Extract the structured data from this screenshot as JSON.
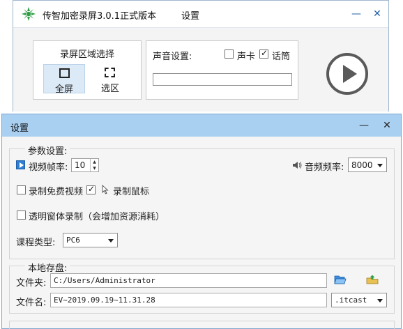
{
  "recorder": {
    "title": "传智加密录屏3.0.1正式版本",
    "settings_link": "设置",
    "region": {
      "title": "录屏区域选择",
      "fullscreen_label": "全屏",
      "selection_label": "选区",
      "active": "fullscreen"
    },
    "sound": {
      "label": "声音设置:",
      "sound_card_label": "声卡",
      "sound_card_checked": false,
      "microphone_label": "话筒",
      "microphone_checked": true
    },
    "icons": [
      "app-logo-icon",
      "minimize-icon",
      "close-icon",
      "play-icon"
    ]
  },
  "settings": {
    "title": "设置",
    "params": {
      "legend": "参数设置:",
      "fps_label": "视频帧率:",
      "fps_value": "10",
      "audio_rate_label": "音频频率:",
      "audio_rate_value": "8000",
      "record_free_video_label": "录制免费视频",
      "record_free_video_checked": false,
      "record_mouse_label": "录制鼠标",
      "record_mouse_checked": true,
      "transparent_label": "透明窗体录制（会增加资源消耗）",
      "transparent_checked": false,
      "course_type_label": "课程类型:",
      "course_type_value": "PC6"
    },
    "storage": {
      "legend": "本地存盘:",
      "folder_label": "文件夹:",
      "folder_value": "C:/Users/Administrator",
      "filename_label": "文件名:",
      "filename_value": "EV~2019.09.19~11.31.28",
      "extension_value": ".itcast"
    },
    "icons": [
      "video-icon",
      "speaker-icon",
      "cursor-icon",
      "open-folder-icon",
      "upload-folder-icon"
    ]
  },
  "colors": {
    "settings_titlebar": "#a9cff1",
    "active_region": "#dce9f7",
    "accent_blue": "#2f7fd3"
  }
}
